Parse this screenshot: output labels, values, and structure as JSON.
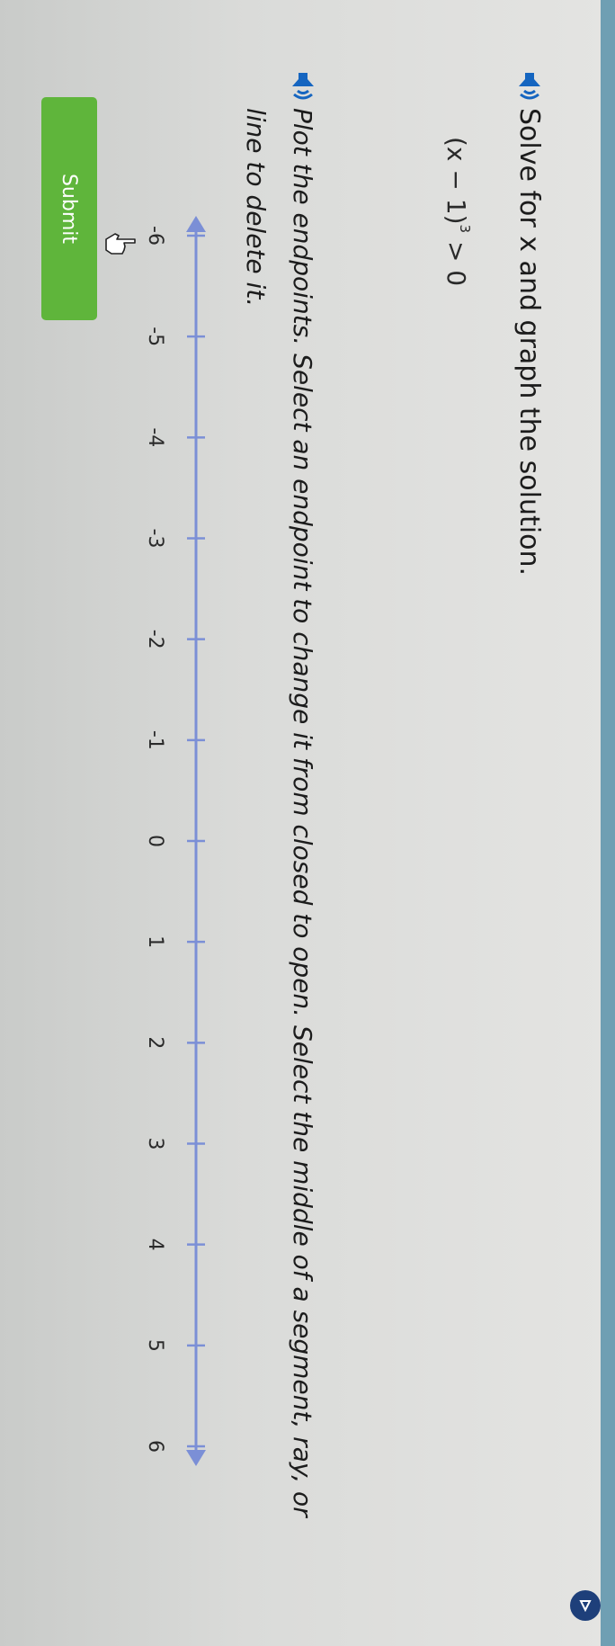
{
  "question": {
    "title": "Solve for x and graph the solution.",
    "equation": {
      "base": "(x − 1)",
      "exponent": "3",
      "relation": " > 0"
    },
    "instructions": "Plot the endpoints. Select an endpoint to change it from closed to open. Select the middle of a segment, ray, or line to delete it."
  },
  "number_line": {
    "ticks": [
      "-6",
      "-5",
      "-4",
      "-3",
      "-2",
      "-1",
      "0",
      "1",
      "2",
      "3",
      "4",
      "5",
      "6"
    ],
    "min": -6,
    "max": 6,
    "color": "#7b8fd6"
  },
  "submit": {
    "label": "Submit",
    "color": "#5fb53b"
  },
  "icons": {
    "audio": "speaker-icon",
    "cursor": "pointing-hand-icon",
    "corner": "triangle-icon"
  },
  "colors": {
    "accent_blue": "#1565c0",
    "top_bar": "#6f9fb3"
  }
}
